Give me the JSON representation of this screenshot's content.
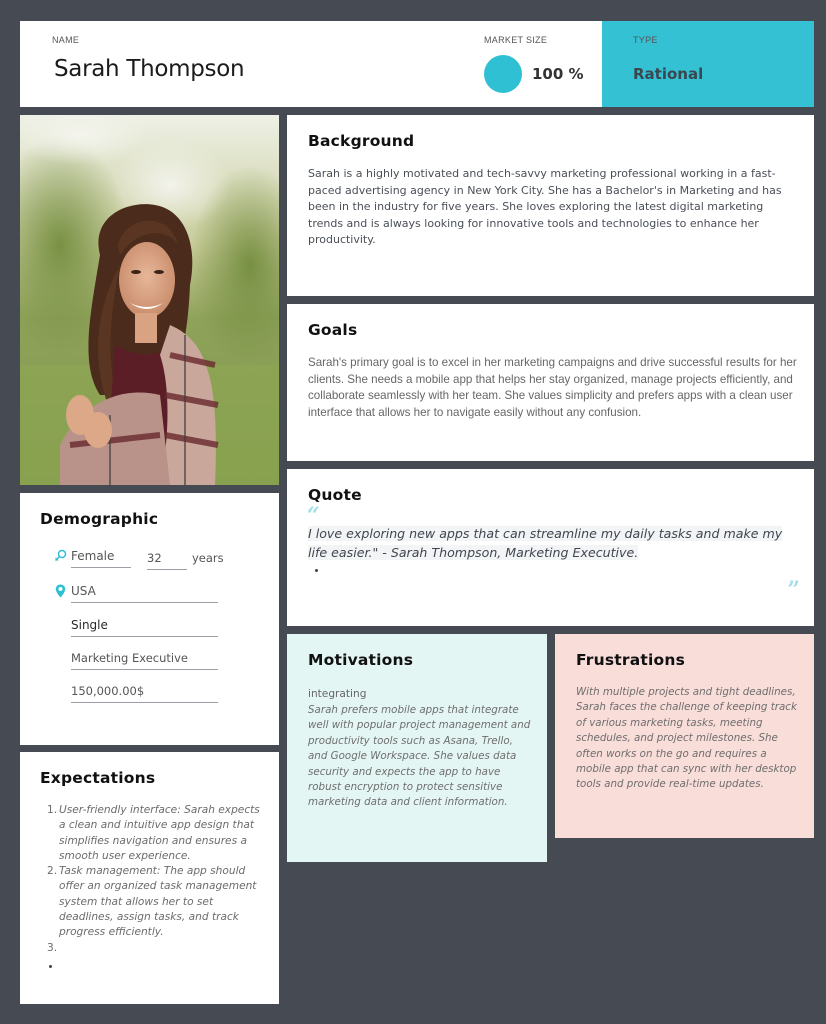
{
  "header": {
    "name_label": "NAME",
    "name": "Sarah Thompson",
    "market_size_label": "MARKET SIZE",
    "market_size_value": "100 %",
    "market_size_percent": 100,
    "type_label": "TYPE",
    "type_value": "Rational"
  },
  "colors": {
    "accent": "#33c1d3",
    "background": "#464a52",
    "motivations_bg": "#e4f6f4",
    "frustrations_bg": "#f9ddd9"
  },
  "photo": {
    "alt": "Portrait of smiling young woman with long brown hair wearing a plaid scarf outdoors"
  },
  "background": {
    "title": "Background",
    "text": "Sarah is a highly motivated and tech-savvy marketing professional working in a fast-paced advertising agency in New York City. She has a Bachelor's in Marketing and has been in the industry for five years. She loves exploring the latest digital marketing trends and is always looking for innovative tools and technologies to enhance her productivity."
  },
  "goals": {
    "title": "Goals",
    "text": "Sarah's primary goal is to excel in her marketing campaigns and drive successful results for her clients. She needs a mobile app that helps her stay organized, manage projects efficiently, and collaborate seamlessly with her team. She values simplicity and prefers apps with a clean user interface that allows her to navigate easily without any confusion."
  },
  "quote": {
    "title": "Quote",
    "open_mark": "“",
    "close_mark": "”",
    "text": "I love exploring new apps that can streamline my daily tasks and make my life easier.\" - Sarah Thompson, Marketing Executive."
  },
  "demographic": {
    "title": "Demographic",
    "gender": "Female",
    "age": "32",
    "age_unit": "years",
    "location": "USA",
    "status": "Single",
    "occupation": "Marketing Executive",
    "income": "150,000.00$",
    "icons": {
      "gender": "gender-icon",
      "location": "location-pin-icon"
    }
  },
  "expectations": {
    "title": "Expectations",
    "items": [
      {
        "num": "1.",
        "text": "User-friendly interface: Sarah expects a clean and intuitive app design that simplifies navigation and ensures a smooth user experience."
      },
      {
        "num": "2.",
        "text": "Task management: The app should offer an organized task management system that allows her to set deadlines, assign tasks, and track progress efficiently."
      },
      {
        "num": "3.",
        "text": ""
      }
    ]
  },
  "motivations": {
    "title": "Motivations",
    "subtitle": "integrating",
    "text": "Sarah prefers mobile apps that integrate well with popular project management and productivity tools such as Asana, Trello, and Google Workspace. She values data security and expects the app to have robust encryption to protect sensitive marketing data and client information."
  },
  "frustrations": {
    "title": "Frustrations",
    "text": "With multiple projects and tight deadlines, Sarah faces the challenge of keeping track of various marketing tasks, meeting schedules, and project milestones. She often works on the go and requires a mobile app that can sync with her desktop tools and provide real-time updates."
  }
}
